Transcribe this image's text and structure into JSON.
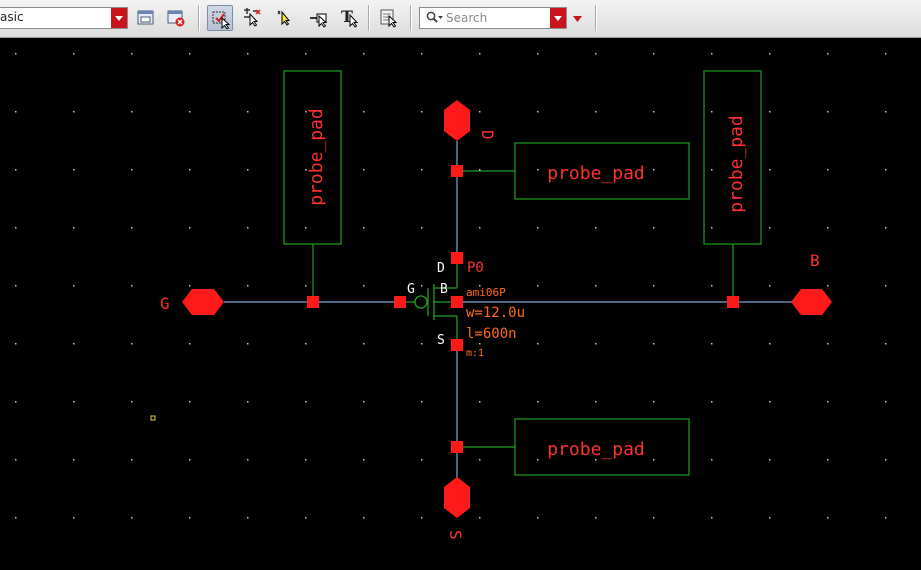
{
  "toolbar": {
    "view_select": {
      "value": "asic"
    },
    "search": {
      "placeholder": "Search"
    },
    "icons": [
      "save-view-icon",
      "close-view-icon",
      "select-tool-icon",
      "select-add-icon",
      "select-point-icon",
      "select-window-icon",
      "text-select-icon",
      "property-editor-icon",
      "search-icon",
      "menu-arrow-icon"
    ]
  },
  "schematic": {
    "colors": {
      "background": "#000000",
      "wire": "#7aa6d8",
      "pin": "#ff2020",
      "label": "#ff3030",
      "instance_box": "#1ea01e",
      "device": "#ff6a1a",
      "terminal_text": "#ffffff",
      "grid_dot": "#c8c8c8"
    },
    "pins": {
      "G": "G",
      "D": "D",
      "S": "S",
      "B": "B"
    },
    "probe_pads": [
      "probe_pad",
      "probe_pad",
      "probe_pad",
      "probe_pad"
    ],
    "transistor": {
      "instance": "P0",
      "model": "ami06P",
      "width": "w=12.0u",
      "length": "l=600n",
      "multiplier": "m:1",
      "terminals": {
        "gate": "G",
        "drain": "D",
        "source": "S",
        "bulk": "B"
      }
    }
  }
}
